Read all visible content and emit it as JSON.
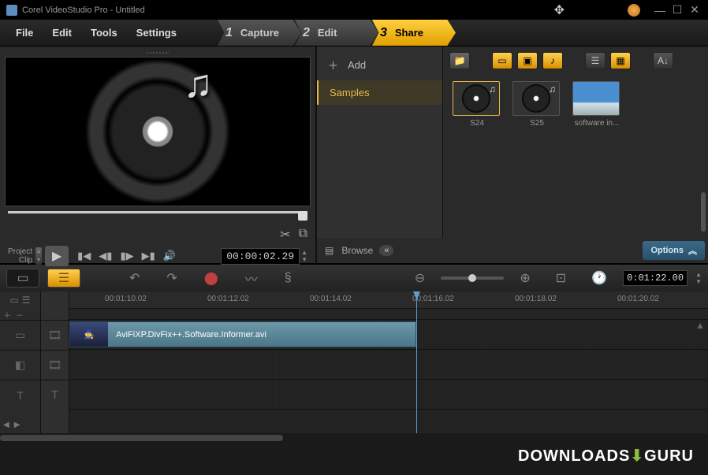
{
  "titlebar": {
    "title": "Corel VideoStudio Pro - Untitled"
  },
  "menu": {
    "file": "File",
    "edit": "Edit",
    "tools": "Tools",
    "settings": "Settings"
  },
  "steps": {
    "s1": {
      "num": "1",
      "label": "Capture"
    },
    "s2": {
      "num": "2",
      "label": "Edit"
    },
    "s3": {
      "num": "3",
      "label": "Share"
    }
  },
  "preview": {
    "project_label": "Project",
    "clip_label": "Clip",
    "timecode": "00:00:02.29"
  },
  "library": {
    "add": "Add",
    "samples": "Samples",
    "browse": "Browse",
    "options": "Options",
    "thumbs": {
      "t1": "S24",
      "t2": "S25",
      "t3": "software in..."
    }
  },
  "timeline": {
    "timecode": "0:01:22.00",
    "ruler": {
      "r1": "00:01:10.02",
      "r2": "00:01:12.02",
      "r3": "00:01:14.02",
      "r4": "00:01:16.02",
      "r5": "00:01:18.02",
      "r6": "00:01:20.02"
    },
    "clip_name": "AviFiXP.DivFix++.Software.Informer.avi"
  },
  "watermark": {
    "downloads": "DOWNLOADS",
    "guru": "GURU"
  }
}
